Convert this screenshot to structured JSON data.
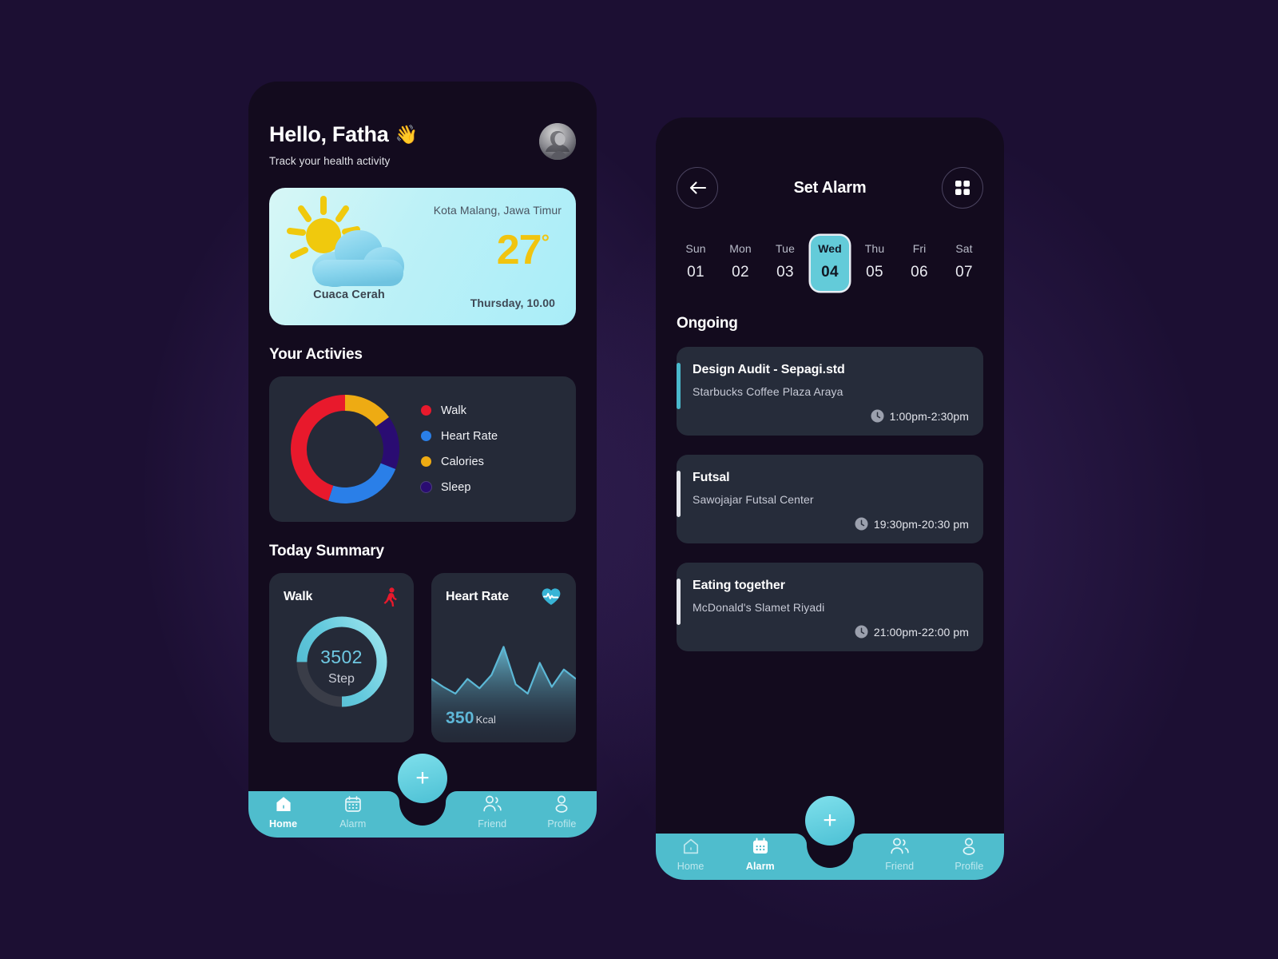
{
  "theme": {
    "page_bg": "#1c0f33",
    "screen_bg": "#130b1e",
    "card_bg": "#252a38",
    "accent_teal": "#4fbdcd",
    "accent_cyan": "#63cbd9",
    "yellow": "#f1c40f"
  },
  "home": {
    "greeting": "Hello, Fatha",
    "greeting_emoji": "👋",
    "subtitle": "Track your health activity",
    "avatar_name": "avatar",
    "weather": {
      "icon": "sun-cloud-icon",
      "condition": "Cuaca Cerah",
      "location": "Kota Malang, Jawa Timur",
      "temperature": "27",
      "degree_symbol": "°",
      "datetime": "Thursday, 10.00"
    },
    "activities_title": "Your Activies",
    "summary_title": "Today Summary",
    "walk_card": {
      "label": "Walk",
      "icon": "walking-person-icon",
      "value": "3502",
      "unit": "Step",
      "progress_percent": 75,
      "ring_color": "#6ed0df",
      "track_color": "#3a3d48"
    },
    "heart_card": {
      "label": "Heart Rate",
      "icon": "heart-pulse-icon",
      "value": "350",
      "unit": "Kcal"
    }
  },
  "chart_data": [
    {
      "type": "pie",
      "title": "Your Activies",
      "subtitle": "",
      "legend_position": "right",
      "labels": [
        "Walk",
        "Heart Rate",
        "Calories",
        "Sleep"
      ],
      "values": [
        45,
        24,
        15,
        16
      ],
      "colors": [
        "#e8192c",
        "#2a7fe8",
        "#eeab13",
        "#2a0c72"
      ],
      "donut": true,
      "inner_radius_ratio": 0.74,
      "start_angle_deg": -90,
      "slice_order": [
        "Calories",
        "Sleep",
        "Heart Rate",
        "Walk"
      ],
      "slice_order_values": [
        15,
        16,
        24,
        45
      ]
    },
    {
      "type": "area",
      "title": "Heart Rate",
      "ylabel": "",
      "xlabel": "",
      "line_color": "#5cb8d6",
      "fill_gradient": [
        "#6fc9e3",
        "#1c2433"
      ],
      "x": [
        0,
        1,
        2,
        3,
        4,
        5,
        6,
        7,
        8,
        9,
        10,
        11,
        12
      ],
      "y": [
        52,
        40,
        30,
        52,
        38,
        58,
        100,
        44,
        30,
        76,
        40,
        66,
        52
      ],
      "grid": false,
      "data_label": "350 Kcal"
    },
    {
      "type": "pie",
      "title": "Walk progress",
      "donut": true,
      "labels": [
        "Completed",
        "Remaining"
      ],
      "values": [
        75,
        25
      ],
      "colors": [
        "#6ed0df",
        "#3a3d48"
      ],
      "center_value": "3502",
      "center_unit": "Step"
    }
  ],
  "alarm": {
    "back_icon": "arrow-left-icon",
    "title": "Set Alarm",
    "grid_icon": "grid-menu-icon",
    "days": [
      {
        "name": "Sun",
        "num": "01",
        "selected": false
      },
      {
        "name": "Mon",
        "num": "02",
        "selected": false
      },
      {
        "name": "Tue",
        "num": "03",
        "selected": false
      },
      {
        "name": "Wed",
        "num": "04",
        "selected": true
      },
      {
        "name": "Thu",
        "num": "05",
        "selected": false
      },
      {
        "name": "Fri",
        "num": "06",
        "selected": false
      },
      {
        "name": "Sat",
        "num": "07",
        "selected": false
      }
    ],
    "section_title": "Ongoing",
    "events": [
      {
        "name": "Design Audit - Sepagi.std",
        "place": "Starbucks Coffee Plaza Araya",
        "time": "1:00pm-2:30pm",
        "bar_color": "#4ab8cc"
      },
      {
        "name": "Futsal",
        "place": "Sawojajar Futsal Center",
        "time": "19:30pm-20:30 pm",
        "bar_color": "#e6e8ee"
      },
      {
        "name": "Eating together",
        "place": "McDonald's Slamet Riyadi",
        "time": "21:00pm-22:00 pm",
        "bar_color": "#e6e8ee"
      }
    ]
  },
  "nav_home": {
    "fab_label": "+",
    "items": [
      {
        "label": "Home",
        "icon": "home-icon",
        "active": true
      },
      {
        "label": "Alarm",
        "icon": "calendar-icon",
        "active": false
      },
      {
        "label": "Friend",
        "icon": "friends-icon",
        "active": false
      },
      {
        "label": "Profile",
        "icon": "person-icon",
        "active": false
      }
    ]
  },
  "nav_alarm": {
    "fab_label": "+",
    "items": [
      {
        "label": "Home",
        "icon": "home-icon",
        "active": false
      },
      {
        "label": "Alarm",
        "icon": "calendar-icon",
        "active": true
      },
      {
        "label": "Friend",
        "icon": "friends-icon",
        "active": false
      },
      {
        "label": "Profile",
        "icon": "person-icon",
        "active": false
      }
    ]
  }
}
